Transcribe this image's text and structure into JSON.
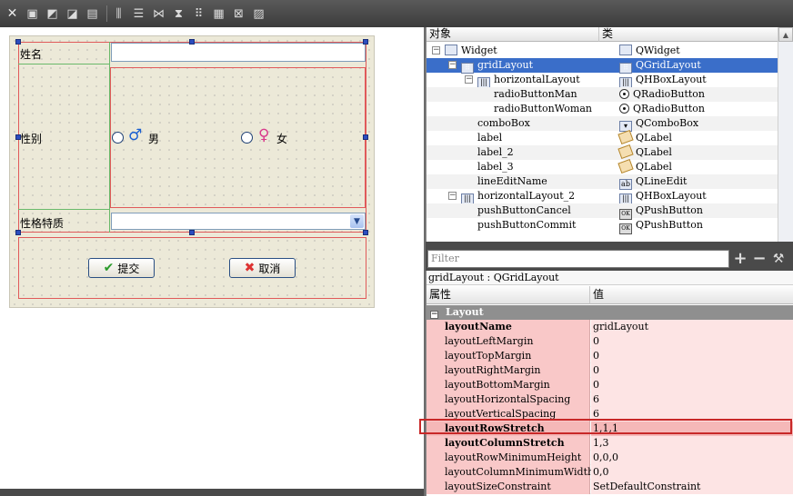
{
  "toolbar": {
    "buttons": [
      "close-icon",
      "edit-widgets-icon",
      "edit-signals-icon",
      "edit-buddies-icon",
      "edit-tab-order-icon",
      "layout-horizontal-icon",
      "layout-vertical-icon",
      "layout-h-splitter-icon",
      "layout-v-splitter-icon",
      "layout-grid-icon",
      "layout-form-icon",
      "break-layout-icon",
      "adjust-size-icon"
    ]
  },
  "form": {
    "name_label": "姓名",
    "name_value": "",
    "gender_label": "性别",
    "male_label": "男",
    "female_label": "女",
    "male_symbol": "♂",
    "female_symbol": "♀",
    "trait_label": "性格特质",
    "trait_value": "",
    "submit_label": "提交",
    "cancel_label": "取消"
  },
  "object_inspector": {
    "header_object": "对象",
    "header_class": "类",
    "rows": [
      {
        "object": "Widget",
        "class": "QWidget",
        "depth": 0
      },
      {
        "object": "gridLayout",
        "class": "QGridLayout",
        "depth": 1,
        "selected": true
      },
      {
        "object": "horizontalLayout",
        "class": "QHBoxLayout",
        "depth": 2
      },
      {
        "object": "radioButtonMan",
        "class": "QRadioButton",
        "depth": 3
      },
      {
        "object": "radioButtonWoman",
        "class": "QRadioButton",
        "depth": 3
      },
      {
        "object": "comboBox",
        "class": "QComboBox",
        "depth": 2
      },
      {
        "object": "label",
        "class": "QLabel",
        "depth": 2
      },
      {
        "object": "label_2",
        "class": "QLabel",
        "depth": 2
      },
      {
        "object": "label_3",
        "class": "QLabel",
        "depth": 2
      },
      {
        "object": "lineEditName",
        "class": "QLineEdit",
        "depth": 2
      },
      {
        "object": "horizontalLayout_2",
        "class": "QHBoxLayout",
        "depth": 1
      },
      {
        "object": "pushButtonCancel",
        "class": "QPushButton",
        "depth": 2
      },
      {
        "object": "pushButtonCommit",
        "class": "QPushButton",
        "depth": 2
      }
    ]
  },
  "filter": {
    "placeholder": "Filter",
    "add_label": "+",
    "remove_label": "−",
    "config_label": "⚒"
  },
  "property_editor": {
    "object_class": "gridLayout : QGridLayout",
    "header_property": "属性",
    "header_value": "值",
    "section": "Layout",
    "rows": [
      {
        "name": "layoutName",
        "value": "gridLayout",
        "bold": true
      },
      {
        "name": "layoutLeftMargin",
        "value": "0"
      },
      {
        "name": "layoutTopMargin",
        "value": "0"
      },
      {
        "name": "layoutRightMargin",
        "value": "0"
      },
      {
        "name": "layoutBottomMargin",
        "value": "0"
      },
      {
        "name": "layoutHorizontalSpacing",
        "value": "6"
      },
      {
        "name": "layoutVerticalSpacing",
        "value": "6"
      },
      {
        "name": "layoutRowStretch",
        "value": "1,1,1",
        "bold": true,
        "highlighted": true
      },
      {
        "name": "layoutColumnStretch",
        "value": "1,3",
        "bold": true
      },
      {
        "name": "layoutRowMinimumHeight",
        "value": "0,0,0"
      },
      {
        "name": "layoutColumnMinimumWidth",
        "value": "0,0"
      },
      {
        "name": "layoutSizeConstraint",
        "value": "SetDefaultConstraint"
      }
    ]
  },
  "colors": {
    "toolbar_bg": "#4a4a4a",
    "selection": "#3a6ec9",
    "property_bg": "#f9c8c8",
    "highlight_border": "#c82828",
    "layout_red": "#e05a5a"
  }
}
